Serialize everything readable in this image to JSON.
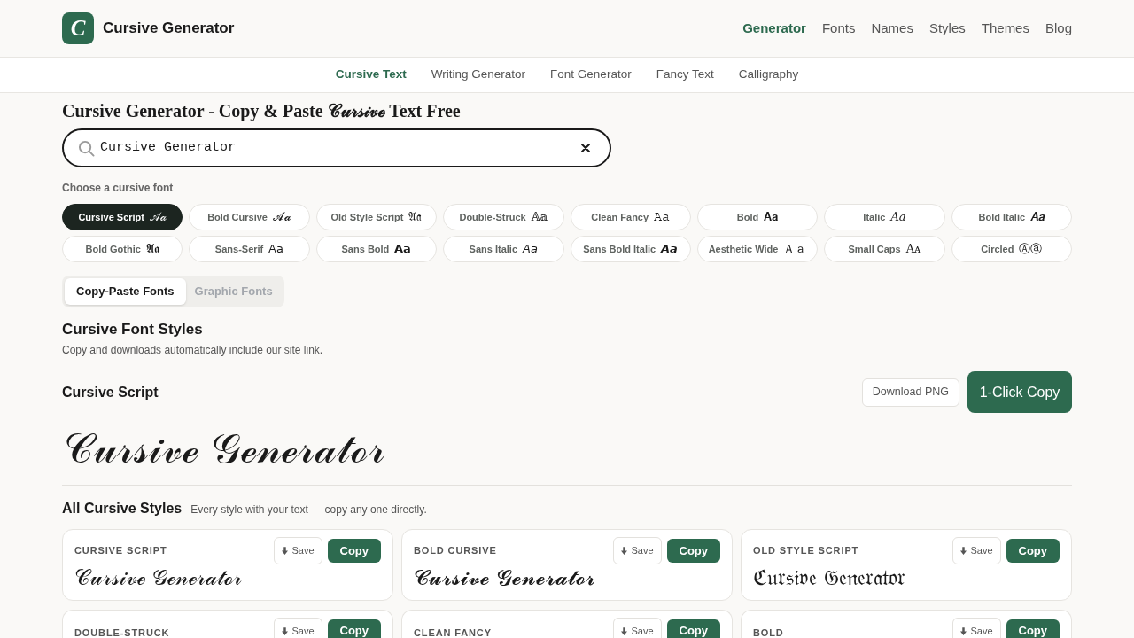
{
  "header": {
    "logo_letter": "C",
    "brand": "Cursive Generator",
    "nav": [
      {
        "label": "Generator",
        "selected": true
      },
      {
        "label": "Fonts",
        "selected": false
      },
      {
        "label": "Names",
        "selected": false
      },
      {
        "label": "Styles",
        "selected": false
      },
      {
        "label": "Themes",
        "selected": false
      },
      {
        "label": "Blog",
        "selected": false
      }
    ]
  },
  "subnav": [
    {
      "label": "Cursive Text",
      "selected": true
    },
    {
      "label": "Writing Generator",
      "selected": false
    },
    {
      "label": "Font Generator",
      "selected": false
    },
    {
      "label": "Fancy Text",
      "selected": false
    },
    {
      "label": "Calligraphy",
      "selected": false
    }
  ],
  "title": "Cursive Generator - Copy & Paste 𝒞𝓊𝓇𝓈𝒾𝓋ℯ Text Free",
  "search": {
    "value": "Cursive Generator"
  },
  "font_picker": {
    "label": "Choose a cursive font",
    "chips": [
      {
        "label": "Cursive Script",
        "sample": "𝒜𝒶",
        "selected": true
      },
      {
        "label": "Bold Cursive",
        "sample": "𝓐𝓪",
        "selected": false
      },
      {
        "label": "Old Style Script",
        "sample": "𝔄𝔞",
        "selected": false
      },
      {
        "label": "Double-Struck",
        "sample": "𝔸𝕒",
        "selected": false
      },
      {
        "label": "Clean Fancy",
        "sample": "𝙰𝚊",
        "selected": false
      },
      {
        "label": "Bold",
        "sample": "𝐀𝐚",
        "selected": false
      },
      {
        "label": "Italic",
        "sample": "𝐴𝑎",
        "selected": false
      },
      {
        "label": "Bold Italic",
        "sample": "𝑨𝒂",
        "selected": false
      },
      {
        "label": "Bold Gothic",
        "sample": "𝕬𝖆",
        "selected": false
      },
      {
        "label": "Sans-Serif",
        "sample": "𝖠𝖺",
        "selected": false
      },
      {
        "label": "Sans Bold",
        "sample": "𝗔𝗮",
        "selected": false
      },
      {
        "label": "Sans Italic",
        "sample": "𝘈𝘢",
        "selected": false
      },
      {
        "label": "Sans Bold Italic",
        "sample": "𝘼𝙖",
        "selected": false
      },
      {
        "label": "Aesthetic Wide",
        "sample": "Ａａ",
        "selected": false
      },
      {
        "label": "Small Caps",
        "sample": "Aᴀ",
        "selected": false
      },
      {
        "label": "Circled",
        "sample": "Ⓐⓐ",
        "selected": false
      }
    ]
  },
  "font_tabs": [
    {
      "label": "Copy-Paste Fonts",
      "selected": true
    },
    {
      "label": "Graphic Fonts",
      "selected": false
    }
  ],
  "styles_section": {
    "heading": "Cursive Font Styles",
    "note": "Copy and downloads automatically include our site link."
  },
  "preview": {
    "style_name": "Cursive Script",
    "download_button": "Download PNG",
    "copy_button": "1-Click Copy",
    "text": "𝒞𝓊𝓇𝓈𝒾𝓋ℯ 𝒢ℯ𝓃ℯ𝓇𝒶𝓉ℴ𝓇"
  },
  "all_styles": {
    "heading": "All Cursive Styles",
    "note": "Every style with your text — copy any one directly.",
    "cards": [
      {
        "label": "CURSIVE SCRIPT",
        "save_button": "Save",
        "copy_button": "Copy",
        "text": "𝒞𝓊𝓇𝓈𝒾𝓋ℯ 𝒢ℯ𝓃ℯ𝓇𝒶𝓉ℴ𝓇"
      },
      {
        "label": "BOLD CURSIVE",
        "save_button": "Save",
        "copy_button": "Copy",
        "text": "𝓒𝓾𝓻𝓼𝓲𝓿𝓮 𝓖𝓮𝓷𝓮𝓻𝓪𝓽𝓸𝓻"
      },
      {
        "label": "OLD STYLE SCRIPT",
        "save_button": "Save",
        "copy_button": "Copy",
        "text": "ℭ𝔲𝔯𝔰𝔦𝔳𝔢 𝔊𝔢𝔫𝔢𝔯𝔞𝔱𝔬𝔯"
      },
      {
        "label": "DOUBLE-STRUCK",
        "save_button": "Save",
        "copy_button": "Copy"
      },
      {
        "label": "CLEAN FANCY",
        "save_button": "Save",
        "copy_button": "Copy"
      },
      {
        "label": "BOLD",
        "save_button": "Save",
        "copy_button": "Copy"
      }
    ]
  }
}
